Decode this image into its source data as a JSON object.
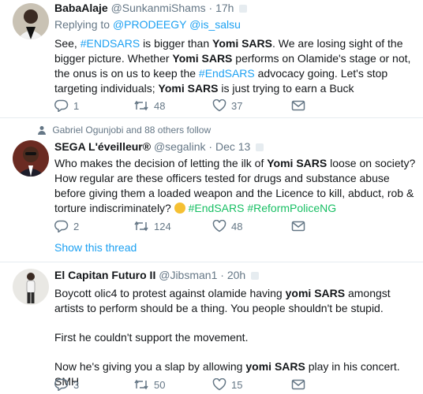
{
  "tweets": [
    {
      "name": "BabaAlaje",
      "handle": "@SunkanmiShams",
      "sep": "·",
      "time": "17h",
      "reply_prefix": "Replying to",
      "reply_to_1": "@PRODEEGY",
      "reply_to_2": "@is_salsu",
      "text": {
        "p1": "See,",
        "t1": "#ENDSARS",
        "p2": "is bigger than",
        "b1": "Yomi SARS",
        "p3": ". We are losing sight of the bigger picture. Whether",
        "b2": "Yomi SARS",
        "p4": "performs on Olamide's stage or not, the onus is on us to keep the",
        "t2": "#EndSARS",
        "p5": "advocacy going. Let's stop targeting individuals;",
        "b3": "Yomi SARS",
        "p6": "is just trying to earn a Buck"
      },
      "replies": "1",
      "retweets": "48",
      "likes": "37"
    },
    {
      "context": "Gabriel Ogunjobi and 88 others follow",
      "name": "SEGA L'éveilleur®",
      "handle": "@segalink",
      "sep": "·",
      "time": "Dec 13",
      "text": {
        "p1": "Who makes the decision of letting the ilk of",
        "b1": "Yomi SARS",
        "p2": "loose on society? How regular are these officers tested for drugs and substance abuse before giving them a loaded weapon and the Licence to kill, abduct, rob & torture indiscriminately?",
        "t1": "#EndSARS",
        "t2": "#ReformPoliceNG"
      },
      "replies": "2",
      "retweets": "124",
      "likes": "48",
      "show_thread": "Show this thread"
    },
    {
      "name": "El Capitan Futuro II",
      "handle": "@Jibsman1",
      "sep": "·",
      "time": "20h",
      "text": {
        "p1": "Boycott olic4 to protest against olamide having",
        "b1": "yomi SARS",
        "p2": "amongst artists to perform should be a thing. You people shouldn't be stupid.",
        "p3": "First he couldn't support the movement.",
        "p4": "Now he's giving you a slap by allowing",
        "b2": "yomi SARS",
        "p5": "play in his concert. SMH"
      },
      "replies": "3",
      "retweets": "50",
      "likes": "15"
    }
  ],
  "colors": {
    "link": "#1da1f2",
    "hashtag": "#17bf63",
    "muted": "#657786"
  }
}
